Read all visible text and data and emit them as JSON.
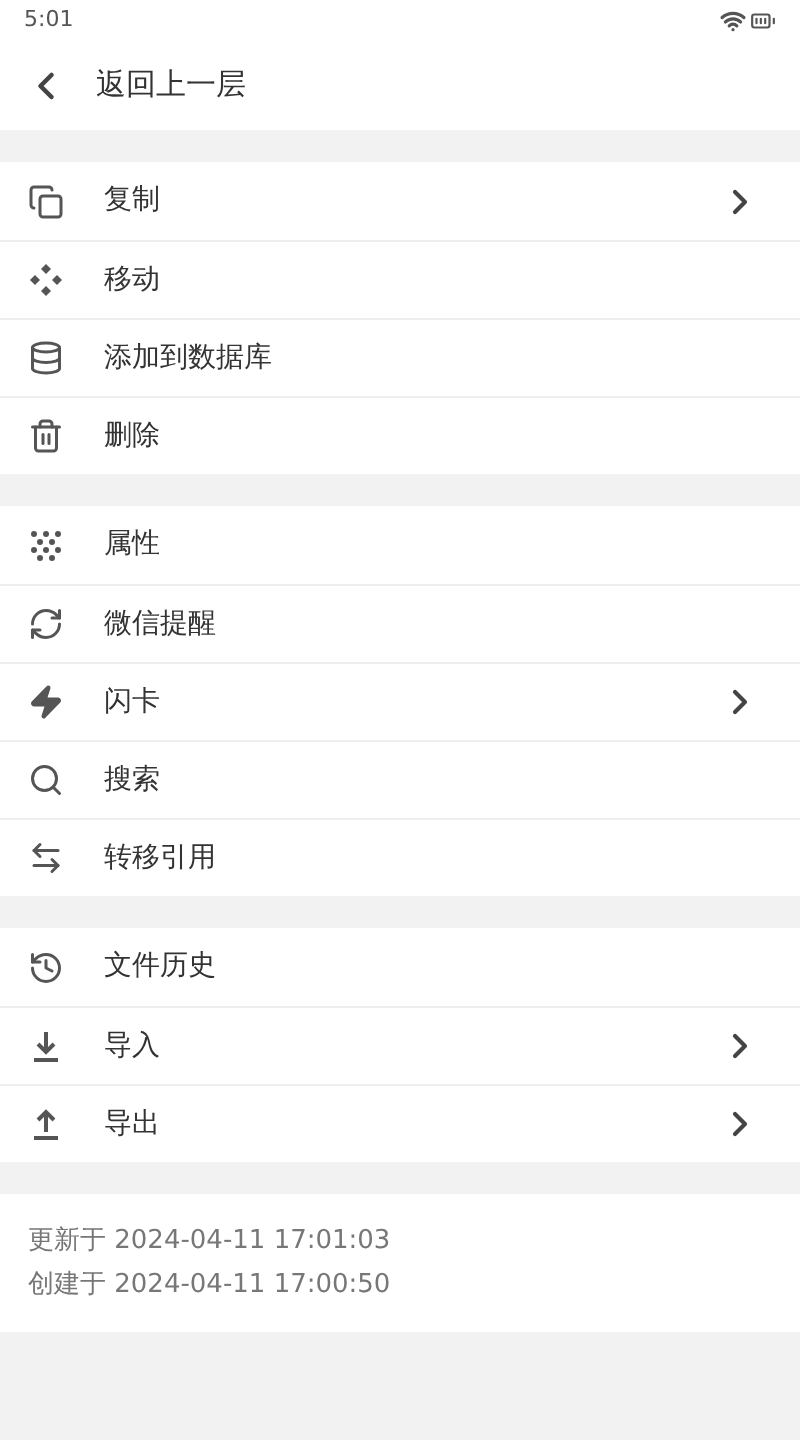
{
  "status_bar": {
    "time": "5:01"
  },
  "header": {
    "title": "返回上一层"
  },
  "groups": [
    {
      "items": [
        {
          "kind": "copy",
          "label": "复制",
          "submenu": true
        },
        {
          "kind": "move",
          "label": "移动",
          "submenu": false
        },
        {
          "kind": "database",
          "label": "添加到数据库",
          "submenu": false
        },
        {
          "kind": "delete",
          "label": "删除",
          "submenu": false
        }
      ]
    },
    {
      "items": [
        {
          "kind": "properties",
          "label": "属性",
          "submenu": false
        },
        {
          "kind": "remind",
          "label": "微信提醒",
          "submenu": false
        },
        {
          "kind": "flash",
          "label": "闪卡",
          "submenu": true
        },
        {
          "kind": "search",
          "label": "搜索",
          "submenu": false
        },
        {
          "kind": "transfer",
          "label": "转移引用",
          "submenu": false
        }
      ]
    },
    {
      "items": [
        {
          "kind": "history",
          "label": "文件历史",
          "submenu": false
        },
        {
          "kind": "import",
          "label": "导入",
          "submenu": true
        },
        {
          "kind": "export",
          "label": "导出",
          "submenu": true
        }
      ]
    }
  ],
  "info": [
    "更新于 2024-04-11 17:01:03",
    "创建于 2024-04-11 17:00:50"
  ]
}
